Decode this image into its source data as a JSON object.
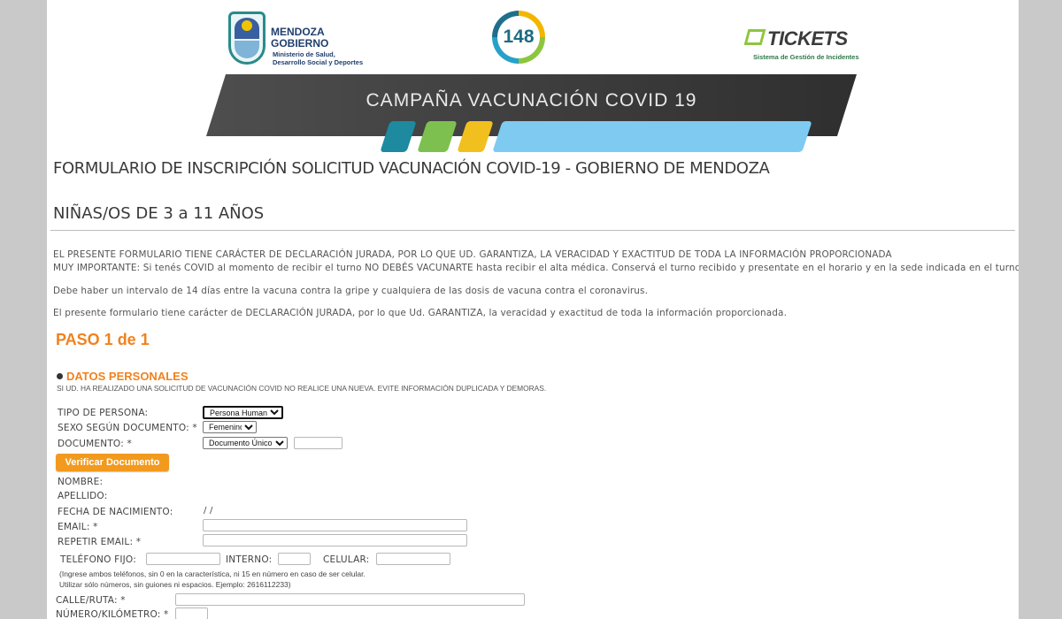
{
  "header": {
    "mendoza_title_1": "MENDOZA",
    "mendoza_title_2": "GOBIERNO",
    "mendoza_sub_1": "Ministerio de Salud,",
    "mendoza_sub_2": "Desarrollo Social y Deportes",
    "hotline": "148",
    "tickets_title": "TICKETS",
    "tickets_sub": "Sistema de Gestión de Incidentes",
    "banner": "CAMPAÑA VACUNACIÓN COVID 19"
  },
  "form": {
    "title": "FORMULARIO DE INSCRIPCIÓN SOLICITUD VACUNACIÓN COVID-19 - GOBIERNO DE MENDOZA",
    "subtitle": "NIÑAS/OS DE 3 a 11 AÑOS",
    "para1": "EL PRESENTE FORMULARIO TIENE CARÁCTER DE DECLARACIÓN JURADA, POR LO QUE UD. GARANTIZA, LA VERACIDAD Y EXACTITUD DE TODA LA INFORMACIÓN PROPORCIONADA",
    "para2": "MUY IMPORTANTE: Si tenés COVID al momento de recibir el turno NO DEBÉS VACUNARTE hasta recibir el alta médica. Conservá el turno recibido y presentate en el horario y en la sede indicada en el turno.",
    "para3": "Debe haber un intervalo de 14 días entre la vacuna contra la gripe y cualquiera de las dosis de vacuna contra el coronavirus.",
    "para4": "El presente formulario tiene carácter de DECLARACIÓN JURADA, por lo que Ud. GARANTIZA, la veracidad y exactitud de toda la información proporcionada.",
    "step": "PASO 1 de 1",
    "section_title": "DATOS PERSONALES",
    "section_notice": "SI UD. HA REALIZADO UNA SOLICITUD DE VACUNACIÓN COVID NO REALICE UNA NUEVA. EVITE INFORMACIÓN DUPLICADA Y DEMORAS.",
    "fields": {
      "tipo_persona_label": "TIPO DE PERSONA:",
      "tipo_persona_value": "Persona Humana",
      "sexo_label": "SEXO SEGÚN DOCUMENTO: *",
      "sexo_value": "Femenino",
      "documento_label": "DOCUMENTO: *",
      "documento_value": "Documento Único",
      "verify_button": "Verificar Documento",
      "nombre_label": "NOMBRE:",
      "apellido_label": "APELLIDO:",
      "fecha_label": "FECHA DE NACIMIENTO:",
      "fecha_value": "/ /",
      "email_label": "EMAIL: *",
      "repetir_email_label": "REPETIR EMAIL: *",
      "telefono_label": "TELÉFONO FIJO:",
      "interno_label": "INTERNO:",
      "celular_label": "CELULAR:",
      "phone_help_1": "(Ingrese ambos teléfonos, sin 0 en la característica, ni 15 en número en caso de ser celular.",
      "phone_help_2": "Utilizar sólo números, sin guiones ni espacios. Ejemplo: 2616112233)",
      "calle_label": "CALLE/RUTA: *",
      "numero_label": "NÚMERO/KILÓMETRO: *"
    }
  }
}
